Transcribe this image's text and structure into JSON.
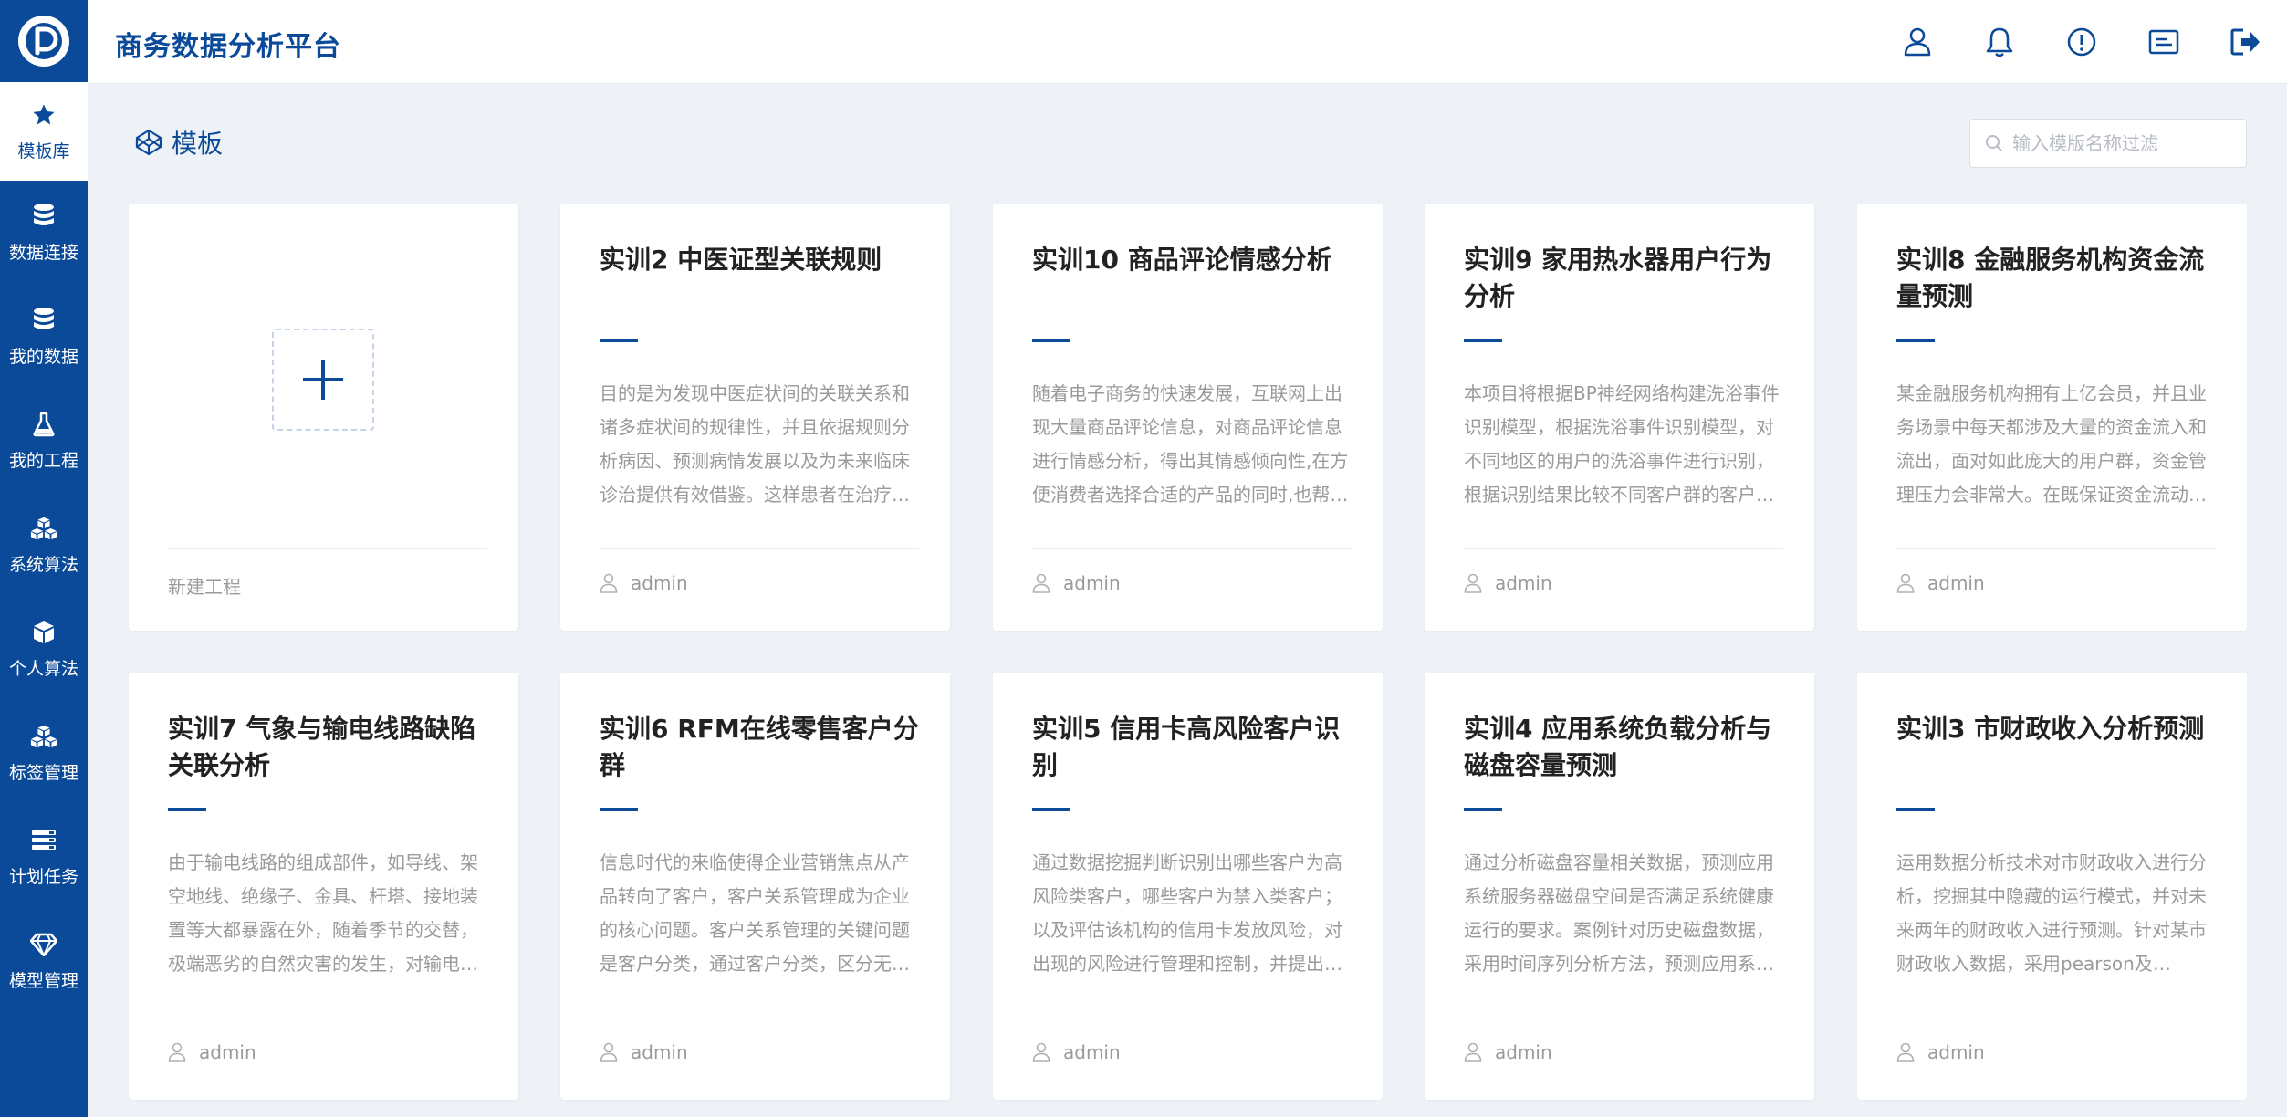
{
  "header": {
    "title": "商务数据分析平台"
  },
  "header_icons": [
    "user-icon",
    "bell-icon",
    "alert-icon",
    "message-card-icon",
    "logout-icon"
  ],
  "sidebar": {
    "items": [
      {
        "label": "模板库",
        "icon": "star-icon",
        "active": true
      },
      {
        "label": "数据连接",
        "icon": "database-icon"
      },
      {
        "label": "我的数据",
        "icon": "database-icon"
      },
      {
        "label": "我的工程",
        "icon": "flask-icon"
      },
      {
        "label": "系统算法",
        "icon": "cubes-icon"
      },
      {
        "label": "个人算法",
        "icon": "cube-icon"
      },
      {
        "label": "标签管理",
        "icon": "cubes-icon"
      },
      {
        "label": "计划任务",
        "icon": "tasks-icon"
      },
      {
        "label": "模型管理",
        "icon": "diamond-icon"
      }
    ]
  },
  "page": {
    "title": "模板",
    "search_placeholder": "输入模版名称过滤"
  },
  "new_card": {
    "label": "新建工程"
  },
  "cards": [
    {
      "title": "实训2 中医证型关联规则",
      "desc": "目的是为发现中医症状间的关联关系和诸多症状间的规律性，并且依据规则分析病因、预测病情发展以及为未来临床诊治提供有效借鉴。这样患者在治疗…",
      "author": "admin"
    },
    {
      "title": "实训10 商品评论情感分析",
      "desc": "随着电子商务的快速发展，互联网上出现大量商品评论信息，对商品评论信息进行情感分析，得出其情感倾向性,在方便消费者选择合适的产品的同时,也帮…",
      "author": "admin"
    },
    {
      "title": "实训9 家用热水器用户行为分析",
      "desc": "本项目将根据BP神经网络构建洗浴事件识别模型，根据洗浴事件识别模型，对不同地区的用户的洗浴事件进行识别，根据识别结果比较不同客户群的客户…",
      "author": "admin"
    },
    {
      "title": "实训8 金融服务机构资金流量预测",
      "desc": "某金融服务机构拥有上亿会员，并且业务场景中每天都涉及大量的资金流入和流出，面对如此庞大的用户群，资金管理压力会非常大。在既保证资金流动…",
      "author": "admin"
    },
    {
      "title": "实训7 气象与输电线路缺陷关联分析",
      "desc": "由于输电线路的组成部件，如导线、架空地线、绝缘子、金具、杆塔、接地装置等大都暴露在外，随着季节的交替，极端恶劣的自然灾害的发生，对输电…",
      "author": "admin"
    },
    {
      "title": "实训6 RFM在线零售客户分群",
      "desc": "信息时代的来临使得企业营销焦点从产品转向了客户，客户关系管理成为企业的核心问题。客户关系管理的关键问题是客户分类，通过客户分类，区分无…",
      "author": "admin"
    },
    {
      "title": "实训5 信用卡高风险客户识别",
      "desc": "通过数据挖掘判断识别出哪些客户为高风险类客户，哪些客户为禁入类客户；以及评估该机构的信用卡发放风险，对出现的风险进行管理和控制，并提出…",
      "author": "admin"
    },
    {
      "title": "实训4 应用系统负载分析与磁盘容量预测",
      "desc": "通过分析磁盘容量相关数据，预测应用系统服务器磁盘空间是否满足系统健康运行的要求。案例针对历史磁盘数据，采用时间序列分析方法，预测应用系…",
      "author": "admin"
    },
    {
      "title": "实训3 市财政收入分析预测",
      "desc": "运用数据分析技术对市财政收入进行分析，挖掘其中隐藏的运行模式，并对未来两年的财政收入进行预测。针对某市财政收入数据，采用pearson及Lasso…",
      "author": "admin"
    }
  ]
}
